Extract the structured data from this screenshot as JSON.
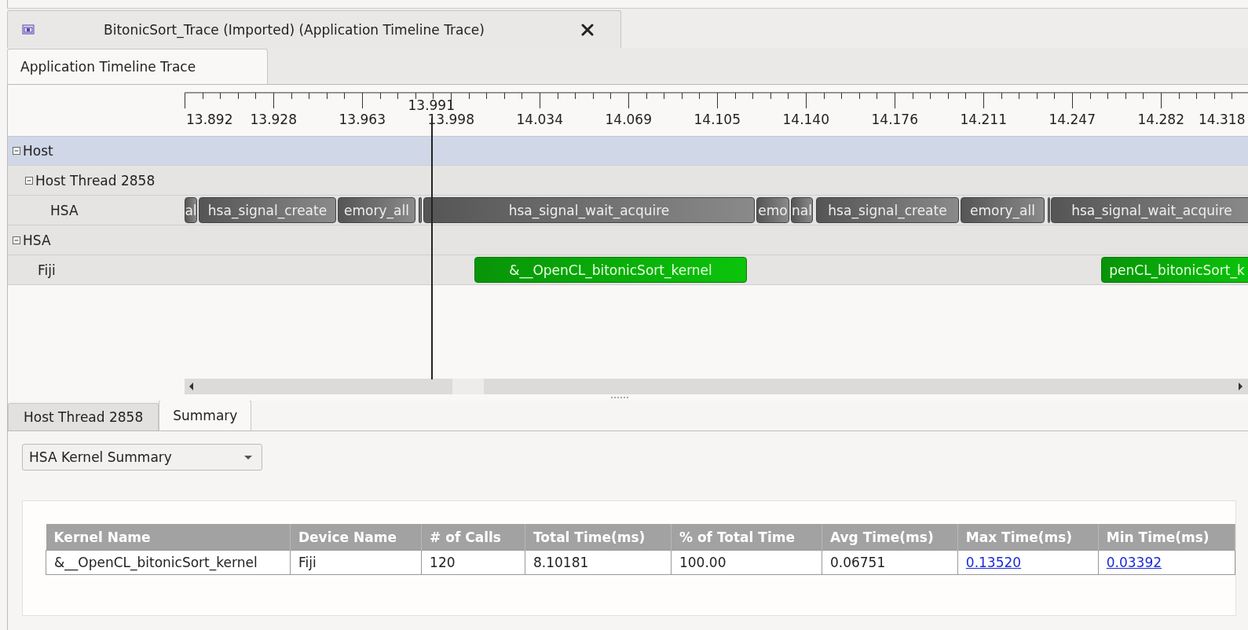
{
  "editor_tab": {
    "title": "BitonicSort_Trace (Imported) (Application Timeline Trace)",
    "selected": true
  },
  "view_tab": {
    "label": "Application Timeline Trace",
    "selected": true
  },
  "ruler": {
    "labels": [
      "13.892",
      "13.928",
      "13.963",
      "13.998",
      "14.034",
      "14.069",
      "14.105",
      "14.140",
      "14.176",
      "14.211",
      "14.247",
      "14.282",
      "14.318"
    ],
    "cursor_label": "13.991"
  },
  "tree": [
    {
      "label": "Host",
      "expanded": true,
      "children": [
        {
          "label": "Host Thread 2858",
          "expanded": true,
          "children": [
            {
              "label": "HSA",
              "kind": "api",
              "bars": [
                {
                  "kind": "call",
                  "text": "al"
                },
                {
                  "kind": "call",
                  "text": "hsa_signal_create"
                },
                {
                  "kind": "call",
                  "text": "emory_all"
                },
                {
                  "kind": "marker"
                },
                {
                  "kind": "call",
                  "text": "hsa_signal_wait_acquire"
                },
                {
                  "kind": "call",
                  "text": "emo"
                },
                {
                  "kind": "call",
                  "text": "nal"
                },
                {
                  "kind": "call",
                  "text": "hsa_signal_create"
                },
                {
                  "kind": "call",
                  "text": "emory_all"
                },
                {
                  "kind": "marker"
                },
                {
                  "kind": "call",
                  "text": "hsa_signal_wait_acquire"
                }
              ]
            }
          ]
        }
      ]
    },
    {
      "label": "HSA",
      "expanded": true,
      "children": [
        {
          "label": "Fiji",
          "kind": "kernel",
          "bars": [
            {
              "kind": "call",
              "text": "&__OpenCL_bitonicSort_kernel"
            },
            {
              "kind": "call",
              "text": "penCL_bitonicSort_k"
            }
          ]
        }
      ]
    }
  ],
  "bottom_tabs": [
    {
      "label": "Host Thread 2858",
      "selected": false
    },
    {
      "label": "Summary",
      "selected": true
    }
  ],
  "summary_dropdown": {
    "value": "HSA Kernel Summary"
  },
  "table": {
    "columns": [
      "Kernel Name",
      "Device Name",
      "# of Calls",
      "Total Time(ms)",
      "% of Total Time",
      "Avg Time(ms)",
      "Max Time(ms)",
      "Min Time(ms)"
    ],
    "rows": [
      [
        {
          "text": "&__OpenCL_bitonicSort_kernel",
          "kind": "text"
        },
        {
          "text": "Fiji",
          "kind": "text"
        },
        {
          "text": "120",
          "kind": "text"
        },
        {
          "text": "8.10181",
          "kind": "text"
        },
        {
          "text": "100.00",
          "kind": "text"
        },
        {
          "text": "0.06751",
          "kind": "text"
        },
        {
          "text": "0.13520",
          "kind": "link"
        },
        {
          "text": "0.03392",
          "kind": "link"
        }
      ]
    ]
  }
}
